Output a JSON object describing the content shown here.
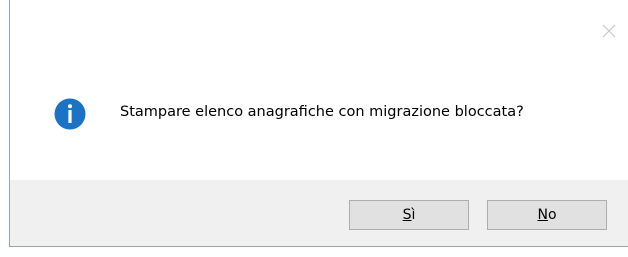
{
  "dialog": {
    "message": "Stampare elenco anagrafiche con migrazione bloccata?",
    "icon": "info-icon",
    "close_icon": "close-icon",
    "accent_color": "#1c73c6"
  },
  "buttons": {
    "yes_label": "Sì",
    "no_label": "No"
  }
}
